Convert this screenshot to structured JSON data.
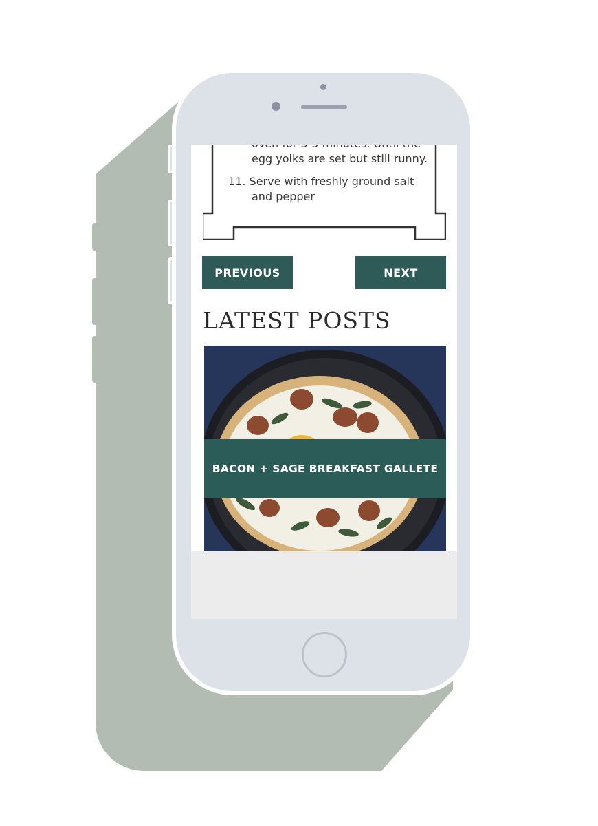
{
  "recipe": {
    "step_10_line1": "oven for 3-5 minutes. Until the",
    "step_10_line2": "egg yolks are set but still runny.",
    "step_11_line1": "11. Serve with freshly ground salt",
    "step_11_line2": "and pepper"
  },
  "navigation": {
    "previous_label": "PREVIOUS",
    "next_label": "NEXT"
  },
  "latest_posts": {
    "title": "LATEST POSTS",
    "posts": [
      {
        "title": "BACON + SAGE BREAKFAST GALLETE",
        "image_icon": "galette-photo"
      }
    ]
  },
  "colors": {
    "accent": "#2e5a57",
    "phone_body": "#dde1e8",
    "shadow": "#b2bcb3"
  }
}
